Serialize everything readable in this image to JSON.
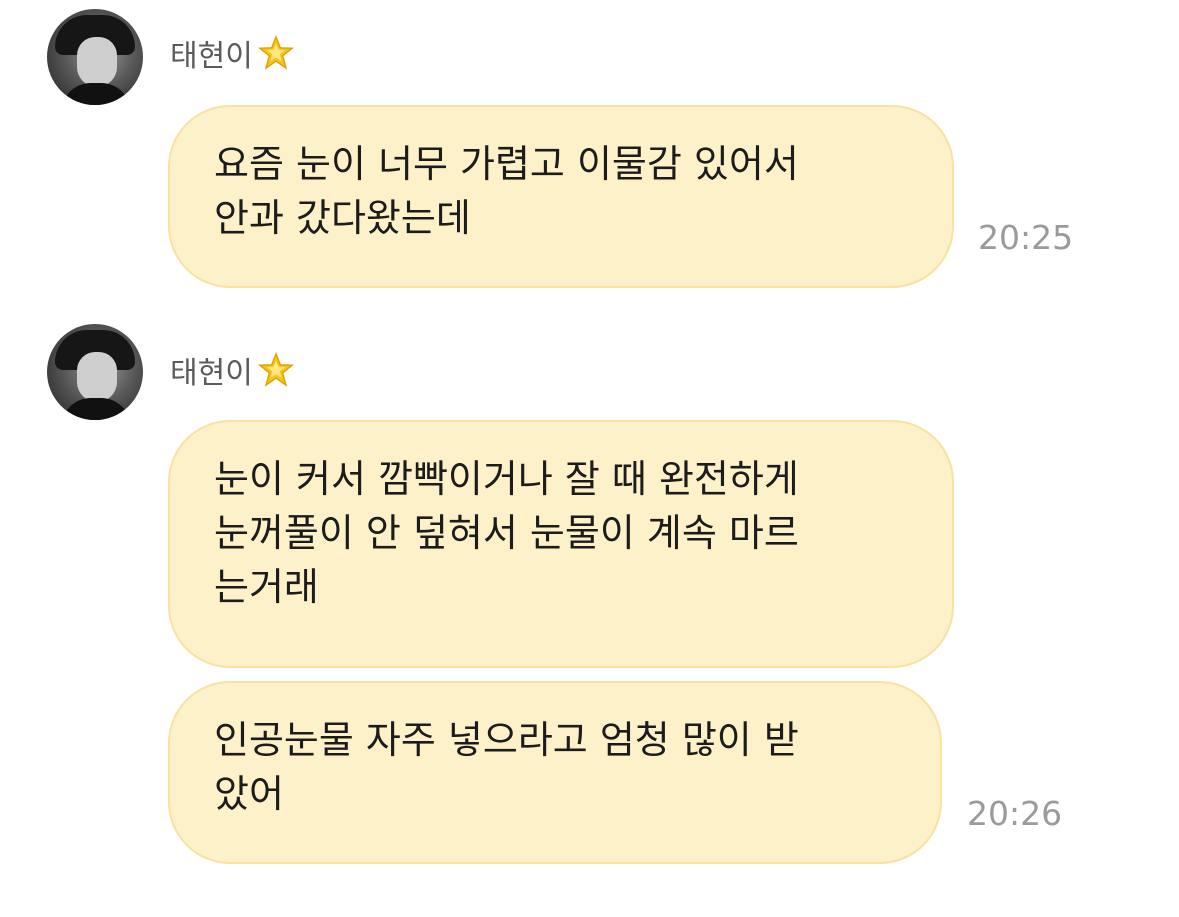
{
  "chat": {
    "groups": [
      {
        "sender": {
          "name": "태현이",
          "badge_icon": "star-icon",
          "avatar": "avatar-photo"
        },
        "messages": [
          {
            "text": "요즘 눈이 너무 가렵고 이물감 있어서\n안과 갔다왔는데",
            "time": "20:25"
          }
        ]
      },
      {
        "sender": {
          "name": "태현이",
          "badge_icon": "star-icon",
          "avatar": "avatar-photo"
        },
        "messages": [
          {
            "text": "눈이 커서 깜빡이거나 잘 때 완전하게\n눈꺼풀이 안 덮혀서 눈물이 계속 마르\n는거래",
            "time": ""
          },
          {
            "text": "인공눈물 자주 넣으라고 엄청 많이 받\n았어",
            "time": "20:26"
          }
        ]
      }
    ]
  },
  "colors": {
    "bubble_bg": "#fdf1c9",
    "bubble_border": "#f7e2a0",
    "sender_name": "#5b5b5b",
    "time": "#9a9a9a",
    "star": "#f5c518"
  }
}
